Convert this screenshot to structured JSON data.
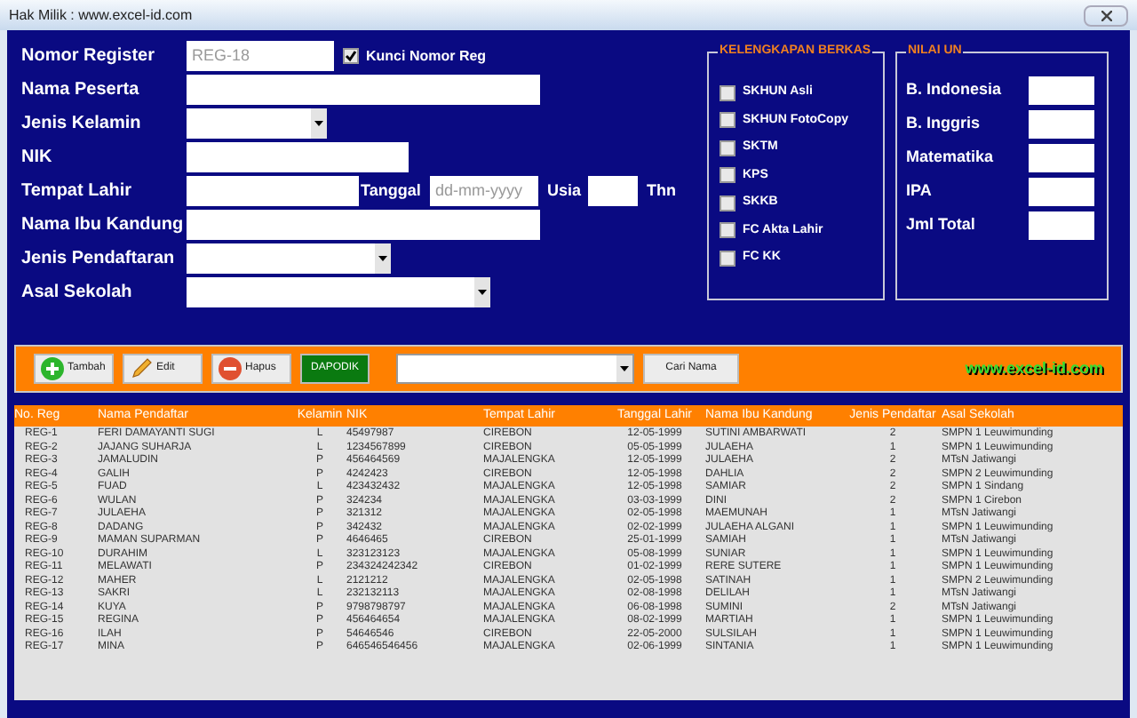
{
  "window": {
    "title": "Hak Milik : www.excel-id.com"
  },
  "form": {
    "nomor_register": {
      "label": "Nomor Register",
      "value": "REG-18"
    },
    "kunci": {
      "label": "Kunci Nomor Reg",
      "checked": true
    },
    "nama_peserta": {
      "label": "Nama Peserta"
    },
    "jenis_kelamin": {
      "label": "Jenis Kelamin"
    },
    "nik": {
      "label": "NIK"
    },
    "tempat_lahir": {
      "label": "Tempat Lahir"
    },
    "tanggal": {
      "label": "Tanggal",
      "placeholder": "dd-mm-yyyy"
    },
    "usia": {
      "label": "Usia",
      "unit": "Thn"
    },
    "nama_ibu": {
      "label": "Nama Ibu Kandung"
    },
    "jenis_pendaftaran": {
      "label": "Jenis Pendaftaran"
    },
    "asal_sekolah": {
      "label": "Asal Sekolah"
    }
  },
  "berkas": {
    "title": "KELENGKAPAN BERKAS",
    "items": [
      {
        "label": "SKHUN Asli",
        "checked": false
      },
      {
        "label": "SKHUN FotoCopy",
        "checked": false
      },
      {
        "label": "SKTM",
        "checked": false
      },
      {
        "label": "KPS",
        "checked": false
      },
      {
        "label": "SKKB",
        "checked": false
      },
      {
        "label": "FC Akta Lahir",
        "checked": false
      },
      {
        "label": "FC KK",
        "checked": false
      }
    ]
  },
  "nilai": {
    "title": "NILAI UN",
    "items": [
      "B. Indonesia",
      "B. Inggris",
      "Matematika",
      "IPA",
      "Jml Total"
    ]
  },
  "toolbar": {
    "buttons": [
      {
        "label": "Tambah",
        "kind": "add"
      },
      {
        "label": "Edit",
        "kind": "edit"
      },
      {
        "label": "Hapus",
        "kind": "delete"
      },
      {
        "label": "DAPODIK",
        "kind": "green"
      }
    ],
    "search_button": "Cari Nama",
    "logo": "www.excel-id.com"
  },
  "table": {
    "columns": [
      "No. Reg",
      "Nama Pendaftar",
      "Kelamin",
      "NIK",
      "Tempat Lahir",
      "Tanggal Lahir",
      "Nama Ibu Kandung",
      "Jenis Pendaftar",
      "Asal Sekolah"
    ],
    "rows": [
      [
        "REG-1",
        "FERI DAMAYANTI SUGI",
        "L",
        "45497987",
        "CIREBON",
        "12-05-1999",
        "SUTINI AMBARWATI",
        "2",
        "SMPN 1 Leuwimunding"
      ],
      [
        "REG-2",
        "JAJANG SUHARJA",
        "L",
        "1234567899",
        "CIREBON",
        "05-05-1999",
        "JULAEHA",
        "1",
        "SMPN 1 Leuwimunding"
      ],
      [
        "REG-3",
        "JAMALUDIN",
        "P",
        "456464569",
        "MAJALENGKA",
        "12-05-1999",
        "JULAEHA",
        "2",
        "MTsN Jatiwangi"
      ],
      [
        "REG-4",
        "GALIH",
        "P",
        "4242423",
        "CIREBON",
        "12-05-1998",
        "DAHLIA",
        "2",
        "SMPN 2 Leuwimunding"
      ],
      [
        "REG-5",
        "FUAD",
        "L",
        "423432432",
        "MAJALENGKA",
        "12-05-1998",
        "SAMIAR",
        "2",
        "SMPN 1 Sindang"
      ],
      [
        "REG-6",
        "WULAN",
        "P",
        "324234",
        "MAJALENGKA",
        "03-03-1999",
        "DINI",
        "2",
        "SMPN 1 Cirebon"
      ],
      [
        "REG-7",
        "JULAEHA",
        "P",
        "321312",
        "MAJALENGKA",
        "02-05-1998",
        "MAEMUNAH",
        "1",
        "MTsN Jatiwangi"
      ],
      [
        "REG-8",
        "DADANG",
        "P",
        "342432",
        "MAJALENGKA",
        "02-02-1999",
        "JULAEHA ALGANI",
        "1",
        "SMPN 1 Leuwimunding"
      ],
      [
        "REG-9",
        "MAMAN SUPARMAN",
        "P",
        "4646465",
        "CIREBON",
        "25-01-1999",
        "SAMIAH",
        "1",
        "MTsN Jatiwangi"
      ],
      [
        "REG-10",
        "DURAHIM",
        "L",
        "323123123",
        "MAJALENGKA",
        "05-08-1999",
        "SUNIAR",
        "1",
        "SMPN 1 Leuwimunding"
      ],
      [
        "REG-11",
        "MELAWATI",
        "P",
        "234324242342",
        "CIREBON",
        "01-02-1999",
        "RERE SUTERE",
        "1",
        "SMPN 1 Leuwimunding"
      ],
      [
        "REG-12",
        "MAHER",
        "L",
        "2121212",
        "MAJALENGKA",
        "02-05-1998",
        "SATINAH",
        "1",
        "SMPN 2 Leuwimunding"
      ],
      [
        "REG-13",
        "SAKRI",
        "L",
        "232132113",
        "MAJALENGKA",
        "02-08-1998",
        "DELILAH",
        "1",
        "MTsN Jatiwangi"
      ],
      [
        "REG-14",
        "KUYA",
        "P",
        "9798798797",
        "MAJALENGKA",
        "06-08-1998",
        "SUMINI",
        "2",
        "MTsN Jatiwangi"
      ],
      [
        "REG-15",
        "REGINA",
        "P",
        "456464654",
        "MAJALENGKA",
        "08-02-1999",
        "MARTIAH",
        "1",
        "SMPN 1 Leuwimunding"
      ],
      [
        "REG-16",
        "ILAH",
        "P",
        "54646546",
        "CIREBON",
        "22-05-2000",
        "SULSILAH",
        "1",
        "SMPN 1 Leuwimunding"
      ],
      [
        "REG-17",
        "MINA",
        "P",
        "646546546456",
        "MAJALENGKA",
        "02-06-1999",
        "SINTANIA",
        "1",
        "SMPN 1 Leuwimunding"
      ]
    ]
  }
}
